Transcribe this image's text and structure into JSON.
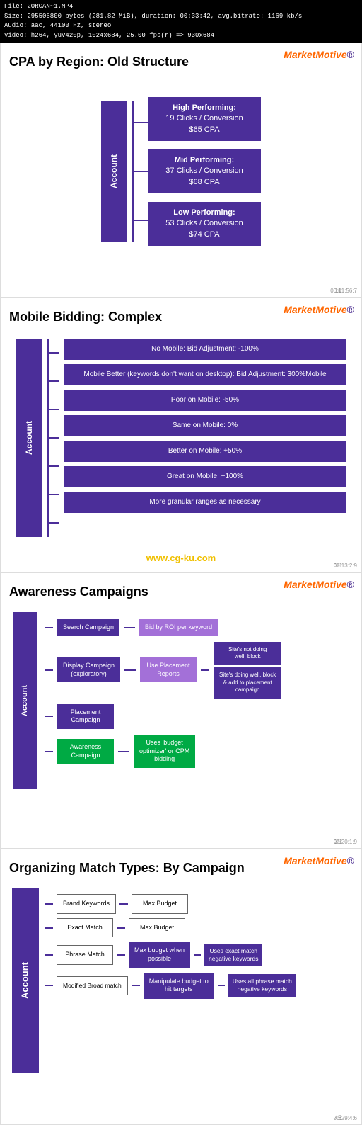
{
  "video_info": {
    "line1": "File: 2ORGAN~1.MP4",
    "line2": "Size: 295506800 bytes (281.82 MiB), duration: 00:33:42, avg.bitrate: 1169 kb/s",
    "line3": "Audio: aac, 44100 Hz, stereo",
    "line4": "Video: h264, yuv420p, 1024x684, 25.00 fps(r) => 930x684"
  },
  "logo_text": "Market",
  "logo_motive": "Motive",
  "slide1": {
    "title": "CPA by Region: Old Structure",
    "account_label": "Account",
    "boxes": [
      {
        "label": "High Performing:\n19 Clicks / Conversion\n$65 CPA"
      },
      {
        "label": "Mid Performing:\n37 Clicks / Conversion\n$68 CPA"
      },
      {
        "label": "Low Performing:\n53 Clicks / Conversion\n$74 CPA"
      }
    ],
    "slide_num": "11",
    "timestamp": "00:01:56:7"
  },
  "slide2": {
    "title": "Mobile Bidding: Complex",
    "account_label": "Account",
    "boxes": [
      "No Mobile: Bid Adjustment: -100%",
      "Mobile Better (keywords don't want on desktop): Bid Adjustment: 300%Mobile",
      "Poor on Mobile: -50%",
      "Same on Mobile: 0%",
      "Better on Mobile: +50%",
      "Great on Mobile: +100%",
      "More granular ranges as necessary"
    ],
    "watermark": "www.cg-ku.com",
    "slide_num": "36",
    "timestamp": "00:13:2:9"
  },
  "slide3": {
    "title": "Awareness Campaigns",
    "account_label": "Account",
    "rows": [
      {
        "col1": "Search Campaign",
        "col2": "Bid by ROI per keyword",
        "col2_color": "light-purple",
        "right": []
      },
      {
        "col1": "Display Campaign\n(exploratory)",
        "col2": "Use Placement\nReports",
        "col2_color": "light-purple",
        "right": [
          "Site's not doing\nwell, block",
          "Site's doing well, block\n& add to placement\ncampaign"
        ]
      },
      {
        "col1": "Placement\nCampaign",
        "col2": "",
        "right": []
      },
      {
        "col1": "Awareness\nCampaign",
        "col1_color": "green",
        "col2": "Uses 'budget\noptimizer' or CPM\nbidding",
        "col2_color": "green",
        "right": []
      }
    ],
    "slide_num": "39",
    "timestamp": "00:20:1:9"
  },
  "slide4": {
    "title": "Organizing Match Types: By Campaign",
    "account_label": "Account",
    "rows": [
      {
        "col1": "Brand Keywords",
        "col2": "Max Budget",
        "right": []
      },
      {
        "col1": "Exact Match",
        "col2": "Max Budget",
        "right": []
      },
      {
        "col1": "Phrase Match",
        "col2": "Max budget when\npossible",
        "right": [
          "Uses exact match\nnegative keywords"
        ]
      },
      {
        "col1": "Modified Broad match",
        "col2": "Manipulate budget to\nhit targets",
        "right": [
          "Uses all phrase match\nnegative keywords"
        ]
      }
    ],
    "slide_num": "45",
    "timestamp": "00:29:4:6"
  }
}
